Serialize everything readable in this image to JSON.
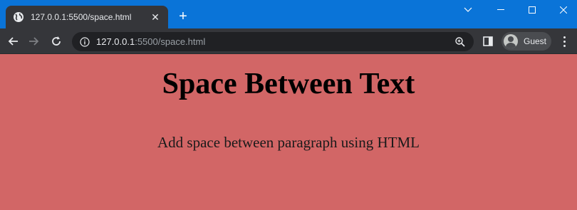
{
  "browser": {
    "tab": {
      "title": "127.0.0.1:5500/space.html",
      "favicon": "globe-icon",
      "close_icon": "close-icon"
    },
    "new_tab_icon": "plus-icon",
    "window_controls": [
      "chevron-down-icon",
      "minimize-icon",
      "maximize-icon",
      "close-icon"
    ],
    "address_bar": {
      "host": "127.0.0.1",
      "rest": ":5500/space.html"
    },
    "profile": {
      "label": "Guest"
    },
    "theme": {
      "titlebar": "#0a74d8",
      "toolbar": "#35363a",
      "omnibox": "#202124"
    }
  },
  "page": {
    "heading": "Space Between Text",
    "paragraph": "Add space between paragraph using HTML",
    "background": "#d26666"
  }
}
